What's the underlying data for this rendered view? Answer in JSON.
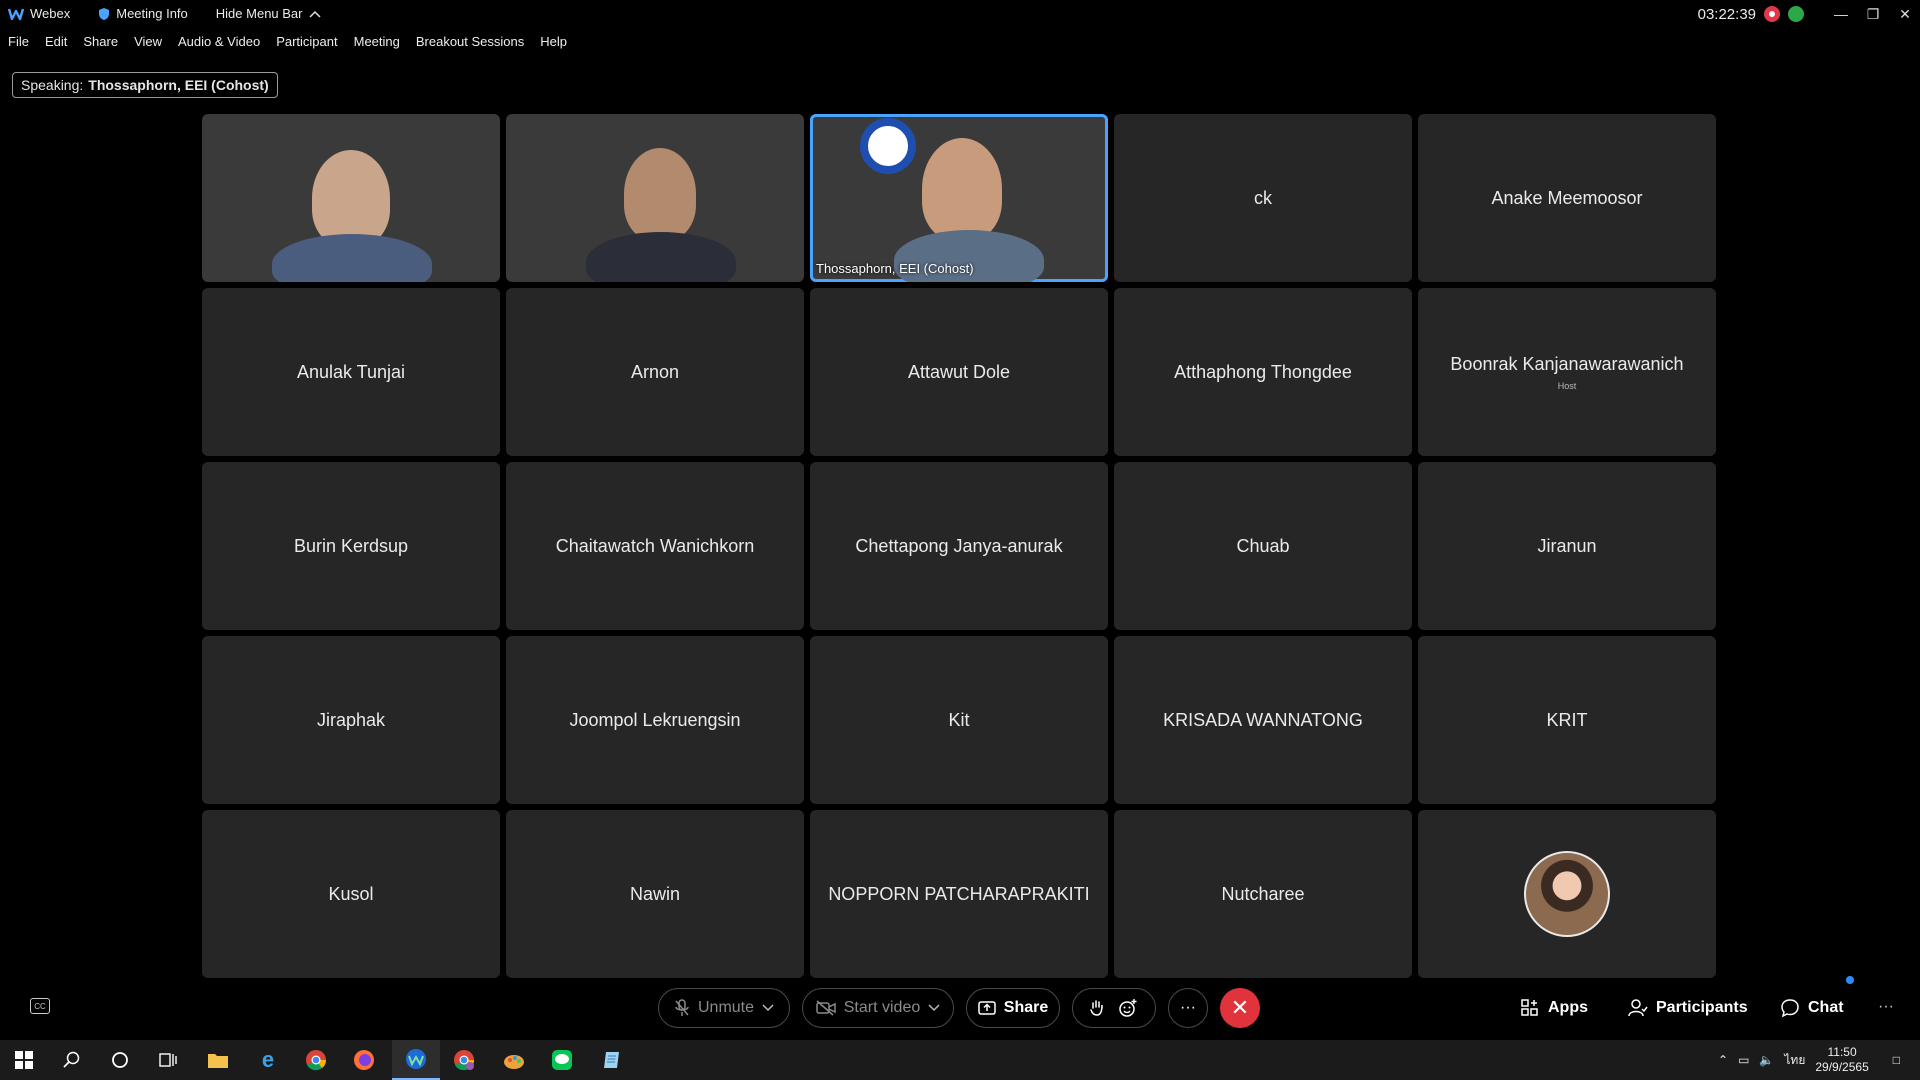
{
  "titlebar": {
    "app_name": "Webex",
    "meeting_info": "Meeting Info",
    "hide_menu": "Hide Menu Bar",
    "clock": "03:22:39"
  },
  "menu": [
    "File",
    "Edit",
    "Share",
    "View",
    "Audio & Video",
    "Participant",
    "Meeting",
    "Breakout Sessions",
    "Help"
  ],
  "speaking": {
    "label": "Speaking:",
    "name": "Thossaphorn, EEI (Cohost)"
  },
  "tiles": [
    {
      "name": "",
      "video": "v1"
    },
    {
      "name": "",
      "video": "v2"
    },
    {
      "name": "Thossaphorn, EEI (Cohost)",
      "video": "v3",
      "active": true
    },
    {
      "name": "ck"
    },
    {
      "name": "Anake Meemoosor"
    },
    {
      "name": "Anulak Tunjai"
    },
    {
      "name": "Arnon"
    },
    {
      "name": "Attawut Dole"
    },
    {
      "name": "Atthaphong Thongdee"
    },
    {
      "name": "Boonrak Kanjanawarawanich",
      "sub": "Host"
    },
    {
      "name": "Burin Kerdsup"
    },
    {
      "name": "Chaitawatch Wanichkorn"
    },
    {
      "name": "Chettapong Janya-anurak"
    },
    {
      "name": "Chuab"
    },
    {
      "name": "Jiranun"
    },
    {
      "name": "Jiraphak"
    },
    {
      "name": "Joompol Lekruengsin"
    },
    {
      "name": "Kit"
    },
    {
      "name": "KRISADA WANNATONG"
    },
    {
      "name": "KRIT"
    },
    {
      "name": "Kusol"
    },
    {
      "name": "Nawin"
    },
    {
      "name": "NOPPORN PATCHARAPRAKITI"
    },
    {
      "name": "Nutcharee"
    },
    {
      "name": "",
      "avatar": true
    }
  ],
  "controls": {
    "unmute": "Unmute",
    "start_video": "Start video",
    "share": "Share",
    "more": "···",
    "apps": "Apps",
    "participants": "Participants",
    "chat": "Chat"
  },
  "taskbar": {
    "lang": "ไทย",
    "time": "11:50",
    "date": "29/9/2565"
  },
  "colors": {
    "accent": "#4aa3ff",
    "end_call": "#e0333b",
    "record": "#e0374a",
    "network": "#2ca84a"
  }
}
